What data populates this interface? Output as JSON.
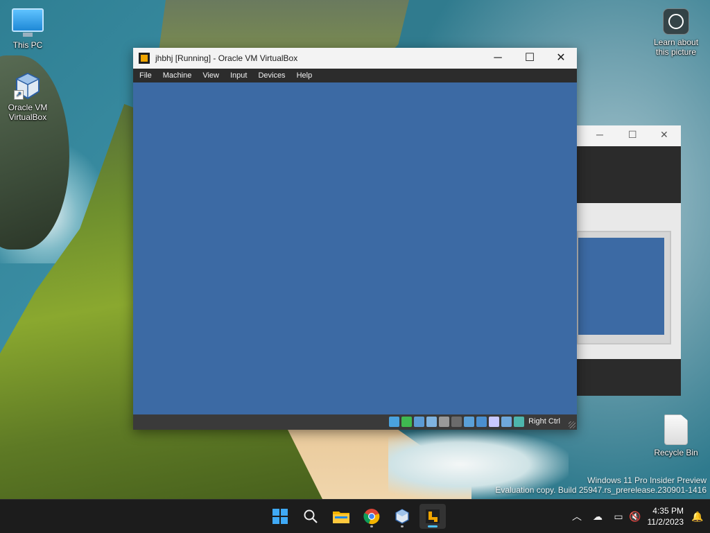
{
  "desktop": {
    "icons": [
      {
        "label": "This PC"
      },
      {
        "label": "Oracle VM VirtualBox"
      },
      {
        "label": "Learn about this picture"
      },
      {
        "label": "Recycle Bin"
      }
    ],
    "watermark": {
      "line1": "Windows 11 Pro Insider Preview",
      "line2": "Evaluation copy. Build 25947.rs_prerelease.230901-1416"
    }
  },
  "vbox_window": {
    "title": "jhbhj [Running] - Oracle VM VirtualBox",
    "controls": {
      "minimize": "─",
      "maximize": "☐",
      "close": "✕"
    },
    "menu": [
      "File",
      "Machine",
      "View",
      "Input",
      "Devices",
      "Help"
    ],
    "screen_color": "#3c6aa4",
    "status_icons": [
      {
        "name": "hard-disk-icon",
        "color": "#4aa3df"
      },
      {
        "name": "optical-drive-icon",
        "color": "#3fb950"
      },
      {
        "name": "audio-icon",
        "color": "#5b9bd5"
      },
      {
        "name": "network-icon",
        "color": "#7fb3e0"
      },
      {
        "name": "usb-icon",
        "color": "#9a9a9a"
      },
      {
        "name": "shared-folders-icon",
        "color": "#6b6b6b"
      },
      {
        "name": "display-icon",
        "color": "#5aa0d8"
      },
      {
        "name": "video-capture-icon",
        "color": "#4a8fcf"
      },
      {
        "name": "guest-additions-icon",
        "color": "#c8c8ff"
      },
      {
        "name": "mouse-integration-icon",
        "color": "#6fa8dc"
      },
      {
        "name": "keyboard-capture-icon",
        "color": "#4db6ac"
      }
    ],
    "host_key": "Right Ctrl"
  },
  "background_window": {
    "controls": {
      "minimize": "─",
      "maximize": "☐",
      "close": "✕"
    }
  },
  "taskbar": {
    "apps": [
      {
        "name": "start"
      },
      {
        "name": "search"
      },
      {
        "name": "file-explorer"
      },
      {
        "name": "chrome"
      },
      {
        "name": "virtualbox-manager"
      },
      {
        "name": "virtualbox-vm"
      }
    ],
    "clock": {
      "time": "4:35 PM",
      "date": "11/2/2023"
    }
  }
}
